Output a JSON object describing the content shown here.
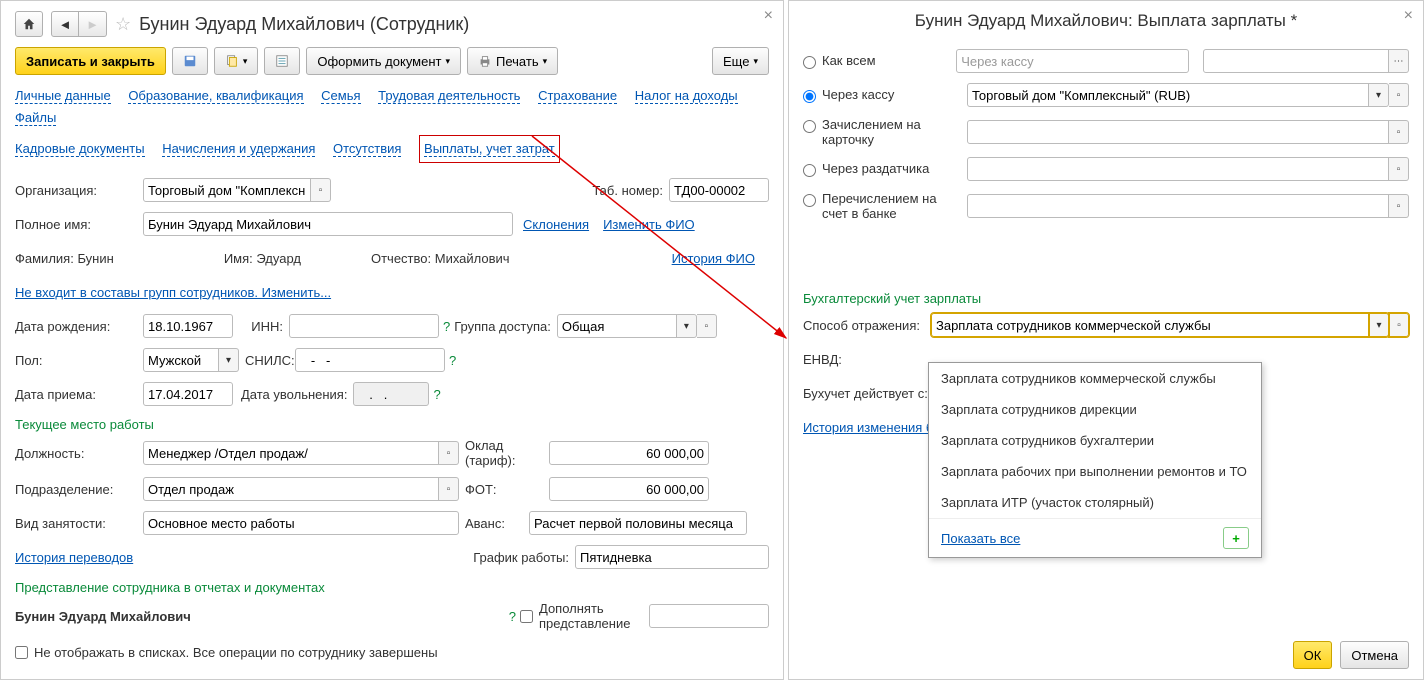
{
  "left": {
    "title": "Бунин Эдуард Михайлович (Сотрудник)",
    "toolbar": {
      "save_close": "Записать и закрыть",
      "create_doc": "Оформить документ",
      "print": "Печать",
      "more": "Еще"
    },
    "nav_links_1": [
      "Личные данные",
      "Образование, квалификация",
      "Семья",
      "Трудовая деятельность",
      "Страхование",
      "Налог на доходы",
      "Файлы"
    ],
    "nav_links_2": [
      "Кадровые документы",
      "Начисления и удержания",
      "Отсутствия"
    ],
    "highlighted_link": "Выплаты, учет затрат",
    "org_label": "Организация:",
    "org_value": "Торговый дом \"Комплексн",
    "tabnum_label": "Таб. номер:",
    "tabnum_value": "ТД00-00002",
    "fullname_label": "Полное имя:",
    "fullname_value": "Бунин Эдуард Михайлович",
    "declensions": "Склонения",
    "change_fio": "Изменить ФИО",
    "surname_label": "Фамилия:",
    "surname_value": "Бунин",
    "name_label": "Имя:",
    "name_value": "Эдуард",
    "patronymic_label": "Отчество:",
    "patronymic_value": "Михайлович",
    "fio_history": "История ФИО",
    "no_group": "Не входит в составы групп сотрудников. Изменить...",
    "dob_label": "Дата рождения:",
    "dob_value": "18.10.1967",
    "inn_label": "ИНН:",
    "access_label": "Группа доступа:",
    "access_value": "Общая",
    "gender_label": "Пол:",
    "gender_value": "Мужской",
    "snils_label": "СНИЛС:",
    "snils_value": "   -   -",
    "hire_label": "Дата приема:",
    "hire_value": "17.04.2017",
    "fire_label": "Дата увольнения:",
    "fire_value": "   .   .",
    "workplace_section": "Текущее место работы",
    "position_label": "Должность:",
    "position_value": "Менеджер /Отдел продаж/",
    "salary_label": "Оклад (тариф):",
    "salary_value": "60 000,00",
    "dept_label": "Подразделение:",
    "dept_value": "Отдел продаж",
    "fot_label": "ФОТ:",
    "fot_value": "60 000,00",
    "employment_label": "Вид занятости:",
    "employment_value": "Основное место работы",
    "advance_label": "Аванс:",
    "advance_value": "Расчет первой половины месяца",
    "transfer_history": "История переводов",
    "schedule_label": "График работы:",
    "schedule_value": "Пятидневка",
    "repr_section": "Представление сотрудника в отчетах и документах",
    "repr_name": "Бунин Эдуард Михайлович",
    "suppl_label": "Дополнять представление",
    "hide_label": "Не отображать в списках. Все операции по сотруднику завершены"
  },
  "right": {
    "title": "Бунин Эдуард Михайлович: Выплата зарплаты *",
    "radios": {
      "as_all": "Как всем",
      "cash": "Через кассу",
      "card": "Зачислением на карточку",
      "distributor": "Через раздатчика",
      "bank": "Перечислением на счет в банке"
    },
    "cash_placeholder": "Через кассу",
    "cash_value": "Торговый дом \"Комплексный\" (RUB)",
    "acct_section": "Бухгалтерский учет зарплаты",
    "reflect_label": "Способ отражения:",
    "reflect_value": "Зарплата сотрудников коммерческой службы",
    "envd_label": "ЕНВД:",
    "valid_from_label": "Бухучет действует с:",
    "history_link": "История изменения бу",
    "dropdown_items": [
      "Зарплата сотрудников коммерческой службы",
      "Зарплата сотрудников дирекции",
      "Зарплата сотрудников бухгалтерии",
      "Зарплата рабочих при выполнении ремонтов и ТО",
      "Зарплата ИТР (участок столярный)"
    ],
    "show_all": "Показать все",
    "ok": "ОК",
    "cancel": "Отмена"
  }
}
